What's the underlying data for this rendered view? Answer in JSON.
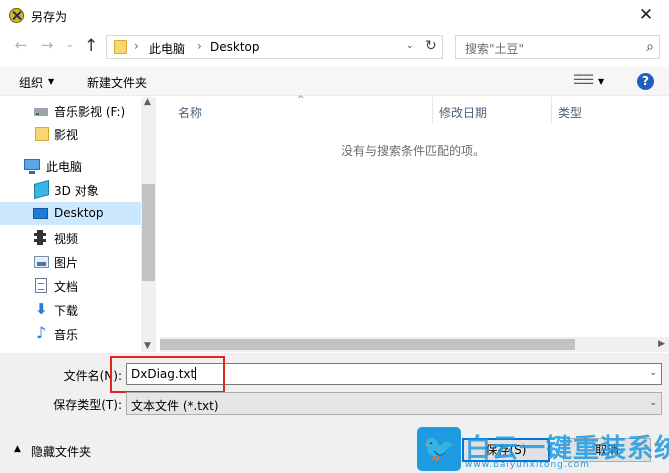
{
  "window": {
    "title": "另存为",
    "close_glyph": "✕"
  },
  "nav": {
    "back": "←",
    "forward": "→",
    "dropdown": "⌄",
    "up": "↑"
  },
  "address": {
    "sep1": "›",
    "crumb1": "此电脑",
    "sep2": "›",
    "crumb2": "Desktop",
    "dropdown": "⌄",
    "refresh": "↻"
  },
  "search": {
    "placeholder": "搜索\"土豆\"",
    "icon": "⌕"
  },
  "toolbar": {
    "organize": "组织",
    "organize_caret": "▼",
    "new_folder": "新建文件夹",
    "view_glyph": "☰☰",
    "view_caret": "▼",
    "help": "?"
  },
  "sidebar": {
    "items": [
      {
        "label": "音乐影视 (F:)",
        "icon": "drive-icon"
      },
      {
        "label": "影视",
        "icon": "folder-icon"
      },
      {
        "label": "此电脑",
        "icon": "computer-icon"
      },
      {
        "label": "3D 对象",
        "icon": "3d-objects-icon"
      },
      {
        "label": "Desktop",
        "icon": "desktop-icon",
        "selected": true
      },
      {
        "label": "视频",
        "icon": "video-icon"
      },
      {
        "label": "图片",
        "icon": "pictures-icon"
      },
      {
        "label": "文档",
        "icon": "documents-icon"
      },
      {
        "label": "下载",
        "icon": "downloads-icon"
      },
      {
        "label": "音乐",
        "icon": "music-icon"
      }
    ],
    "scroll_up": "▲",
    "scroll_down": "▼"
  },
  "filelist": {
    "sort_glyph": "^",
    "columns": [
      "名称",
      "修改日期",
      "类型"
    ],
    "empty_message": "没有与搜索条件匹配的项。",
    "scroll_right": "▶"
  },
  "form": {
    "filename_label": "文件名(N):",
    "filename_value": "DxDiag.txt",
    "filetype_label": "保存类型(T):",
    "filetype_value": "文本文件 (*.txt)",
    "dropdown": "⌄"
  },
  "footer": {
    "hide_caret": "▲",
    "hide_folders": "隐藏文件夹",
    "save": "保存(S)",
    "cancel": "取消"
  },
  "watermark": {
    "title": "白云一键重装系统",
    "url": "www.baiyunxitong.com",
    "bird": "🐦"
  },
  "colors": {
    "selected_bg": "#cce8ff",
    "accent": "#0078d7",
    "highlight_box": "#e2251d",
    "watermark": "#1e9be0"
  }
}
